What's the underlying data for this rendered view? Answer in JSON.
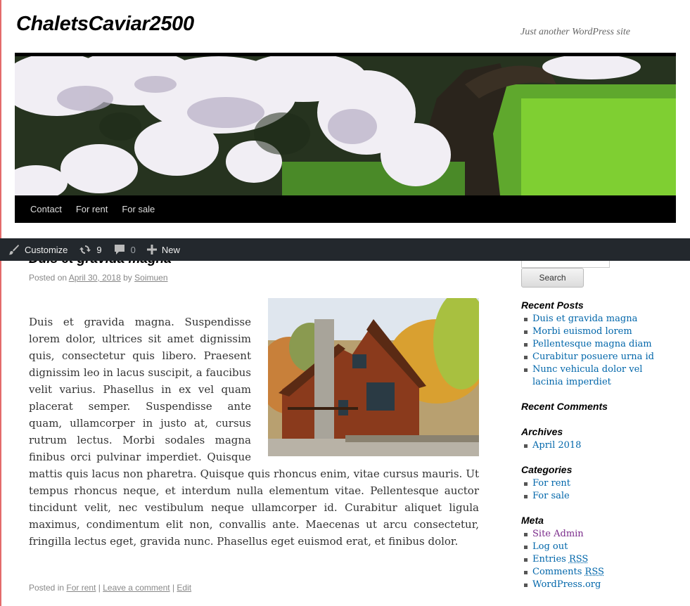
{
  "site": {
    "title": "ChaletsCaviar2500",
    "description": "Just another WordPress site"
  },
  "nav": {
    "items": [
      "Contact",
      "For rent",
      "For sale"
    ]
  },
  "admin_bar": {
    "customize_label": "Customize",
    "updates_count": "9",
    "comments_count": "0",
    "new_label": "New"
  },
  "post": {
    "title": "Duis et gravida magna",
    "posted_on_label": "Posted on",
    "date": "April 30, 2018",
    "by_label": "by",
    "author": "Soimuen",
    "body": "Duis et gravida magna. Suspendisse lorem dolor, ultrices sit amet dignissim quis, consectetur quis libero. Praesent dignissim leo in lacus suscipit, a faucibus velit varius. Phasellus in ex vel quam placerat semper. Suspendisse ante quam, ullamcorper in justo at, cursus rutrum lectus. Morbi sodales magna finibus orci pulvinar imperdiet. Quisque mattis quis lacus non pharetra. Quisque quis rhoncus enim, vitae cursus mauris. Ut tempus rhoncus neque, et interdum nulla elementum vitae. Pellentesque auctor tincidunt velit, nec vestibulum neque ullamcorper id. Curabitur aliquet ligula maximus, condimentum elit non, convallis ante. Maecenas ut arcu consectetur, fringilla lectus eget, gravida nunc. Phasellus eget euismod erat, et finibus dolor.",
    "posted_in_label": "Posted in",
    "category": "For rent",
    "separator": "|",
    "leave_comment": "Leave a comment",
    "edit": "Edit"
  },
  "sidebar": {
    "search_button": "Search",
    "recent_posts": {
      "title": "Recent Posts",
      "items": [
        "Duis et gravida magna",
        "Morbi euismod lorem",
        "Pellentesque magna diam",
        "Curabitur posuere urna id",
        "Nunc vehicula dolor vel lacinia imperdiet"
      ]
    },
    "recent_comments": {
      "title": "Recent Comments"
    },
    "archives": {
      "title": "Archives",
      "items": [
        "April 2018"
      ]
    },
    "categories": {
      "title": "Categories",
      "items": [
        "For rent",
        "For sale"
      ]
    },
    "meta": {
      "title": "Meta",
      "items": [
        "Site Admin",
        "Log out",
        "Entries",
        "Comments",
        "WordPress.org"
      ],
      "rss": "RSS"
    }
  },
  "colors": {
    "link": "#0066aa",
    "visited_link": "#7a2a8a",
    "admin_bar": "#23282d",
    "nav": "#000000"
  }
}
